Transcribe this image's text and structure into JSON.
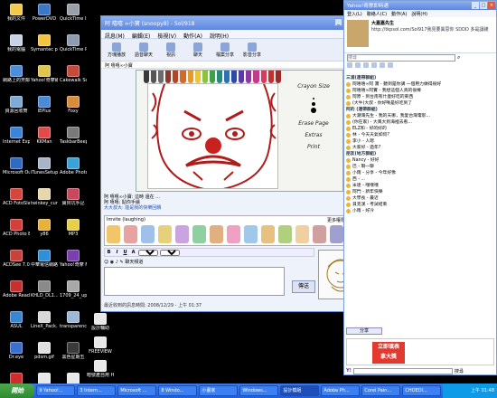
{
  "desktop_icons": [
    {
      "label": "我的文件",
      "color": "#f2c94c"
    },
    {
      "label": "PowerDVD",
      "color": "#3b79c6"
    },
    {
      "label": "QuickTime Install...",
      "color": "#9aa0aa"
    },
    {
      "label": "我的電腦",
      "color": "#c9d3e8"
    },
    {
      "label": "Symantec pcAnywhere",
      "color": "#f5c542"
    },
    {
      "label": "QuickTime Player",
      "color": "#8f9bb0"
    },
    {
      "label": "網路上的芳鄰",
      "color": "#4c8ed9"
    },
    {
      "label": "Yahoo!奇摩即時通",
      "color": "#e0c64d"
    },
    {
      "label": "Cakewalk Sonar 5",
      "color": "#c54a3b"
    },
    {
      "label": "資源回收筒",
      "color": "#7fa9d6"
    },
    {
      "label": "IEPlus",
      "color": "#4a8ad6"
    },
    {
      "label": "Foxy",
      "color": "#d98c3a"
    },
    {
      "label": "Internet Explorer",
      "color": "#3b84d8"
    },
    {
      "label": "KKMan",
      "color": "#e04a4a"
    },
    {
      "label": "TaskbarBeep",
      "color": "#7a7a7a"
    },
    {
      "label": "Microsoft Outlook",
      "color": "#2f6bc2"
    },
    {
      "label": "iTunesSetup",
      "color": "#a9b4c9"
    },
    {
      "label": "Adobe Photoshop",
      "color": "#3aa3d8"
    },
    {
      "label": "ACD FotoSlate 3.1",
      "color": "#d8453c"
    },
    {
      "label": "twinkey_cure_...",
      "color": "#e8d7a8"
    },
    {
      "label": "寶貝坑手記",
      "color": "#c9485b"
    },
    {
      "label": "ACD Photo Editor 3.1",
      "color": "#d43f3a"
    },
    {
      "label": "y86",
      "color": "#e8b23a"
    },
    {
      "label": "MP3",
      "color": "#e8cf4a"
    },
    {
      "label": "ACDSee 7.0",
      "color": "#c9413b"
    },
    {
      "label": "中華電信網路電話",
      "color": "#2f8fd8"
    },
    {
      "label": "Yahoo!奇摩 Messenger",
      "color": "#7b3fb0"
    },
    {
      "label": "Adobe Reader 7.0",
      "color": "#c4312e"
    },
    {
      "label": "KHLD_DL1...",
      "color": "#8a8a8a"
    },
    {
      "label": "1709_24_upfo...",
      "color": "#a8a8a8"
    },
    {
      "label": "ASUL",
      "color": "#3a86d0"
    },
    {
      "label": "LineX_Pack...",
      "color": "#d8d8d8"
    },
    {
      "label": "transparency",
      "color": "#a0b8d8"
    },
    {
      "label": "Dr.eye",
      "color": "#3b6fd0"
    },
    {
      "label": "pdsm.gif",
      "color": "#e0e0e0"
    },
    {
      "label": "黑色星期五",
      "color": "#3a3a3a"
    },
    {
      "label": "Nero StartSmart",
      "color": "#d02c2c"
    },
    {
      "label": "ppsth",
      "color": "#e8e8e8"
    },
    {
      "label": "h1fd",
      "color": "#e8e8e8"
    }
  ],
  "extra_icons": [
    {
      "label": "設計輔助",
      "color": "#e8e8e8"
    },
    {
      "label": "FREEVIEW",
      "color": "#e8e8e8"
    },
    {
      "label": "暗號產自用 HP",
      "color": "#e8e8e8"
    }
  ],
  "chat": {
    "title": "阿 嘻嘻 ∞小寶 (snoopy8) - Sol/918",
    "menu": [
      "訊息(M)",
      "編輯(E)",
      "檢視(V)",
      "動作(A)",
      "說明(H)"
    ],
    "tools": [
      "方塊播放",
      "語音聊天",
      "視訊",
      "聊天",
      "檔案分享",
      "影音分享"
    ],
    "tab_label": "阿 嘻嘻∞小寶",
    "side_labels": [
      "Crayon Size",
      "Erase Page",
      "Extras",
      "Print"
    ],
    "log_lines": [
      "阿 嘻嘻∞小寶: 這時 還在 ...",
      "阿 嘻嘻: 貼你手繪",
      "大大叔大: 能是我的快樂回饋"
    ],
    "emote_label": "Imvite (laughing)",
    "emote_more": "更多權限與功能",
    "font_name": "Arial",
    "font_size": "10",
    "smiley_label": "聊天頻道",
    "send_label": "傳送",
    "status_text": "最近收到的訊息時間: 2008/12/29 - 上午 01:37"
  },
  "messenger": {
    "title": "Yahoo!奇摩即時通",
    "menu": [
      "登入(L)",
      "聯絡人(C)",
      "動作(A)",
      "說明(H)"
    ],
    "name": "大嘉嘉先生",
    "url": "http://tkpsol.com/Sol917我見要異思你 SDDD 多是讓錢",
    "search_placeholder": "搜尋",
    "groups": [
      "三浦(連帶群組)",
      "阿的 (連帶群組)",
      "朋友(地方群組)"
    ],
    "contacts": [
      "阿嘻嘻∞阿 寶 - 聽到是你講 一個用力做得很好",
      "阿嘻嘻∞阿實 - 我想這個人真的很棒",
      "阿原 - 到台南有什麼好吃的東西",
      "(大牛)大叔 - 你好嗎是好吃到了",
      "大潮灣先生 - 我的天哪，我愛台灣電影...",
      "(你在家) - 大風大到海裡去看...",
      "ELZ和 - 好的好的",
      "林 - 今天天氣如何?",
      "李小 - 人嗯",
      "大家好 - 過年?",
      "Nancy - 好好",
      "巴 - 聊一聊",
      "小雨 - 分享 - 今年好像",
      "西 - ...",
      "米達 - 嘿嘿嘿",
      "阿門 - 新年快樂",
      "大學長 - 最近",
      "貝克漢 - 考試結束",
      "小雨 - 好冷"
    ],
    "share_label": "分享",
    "ad_text": [
      "立即填表",
      "拿大獎"
    ],
    "search_label": "搜尋"
  },
  "taskbar": {
    "start": "開始",
    "tasks": [
      "9 Yahoo!...",
      "3 Intern...",
      "Microsoft ...",
      "8 Windo...",
      "小畫家",
      "Windows...",
      "設計模組",
      "Adobe Ph...",
      "Corel Pain...",
      "CHOEDI..."
    ],
    "clock": "上午 01:48"
  },
  "colors": {
    "pencils": [
      "#3a3a3a",
      "#555",
      "#6b6b6b",
      "#8a3a2b",
      "#b2462b",
      "#d36a2b",
      "#e69a2b",
      "#e8c53a",
      "#8fc43a",
      "#3aa34a",
      "#2a8a7a",
      "#2a73b8",
      "#2a4ca8",
      "#5a3aa8",
      "#8a3aa8",
      "#c43a8a",
      "#d83a5a",
      "#c43030",
      "#a02a2a",
      "#f2f2f2"
    ]
  }
}
